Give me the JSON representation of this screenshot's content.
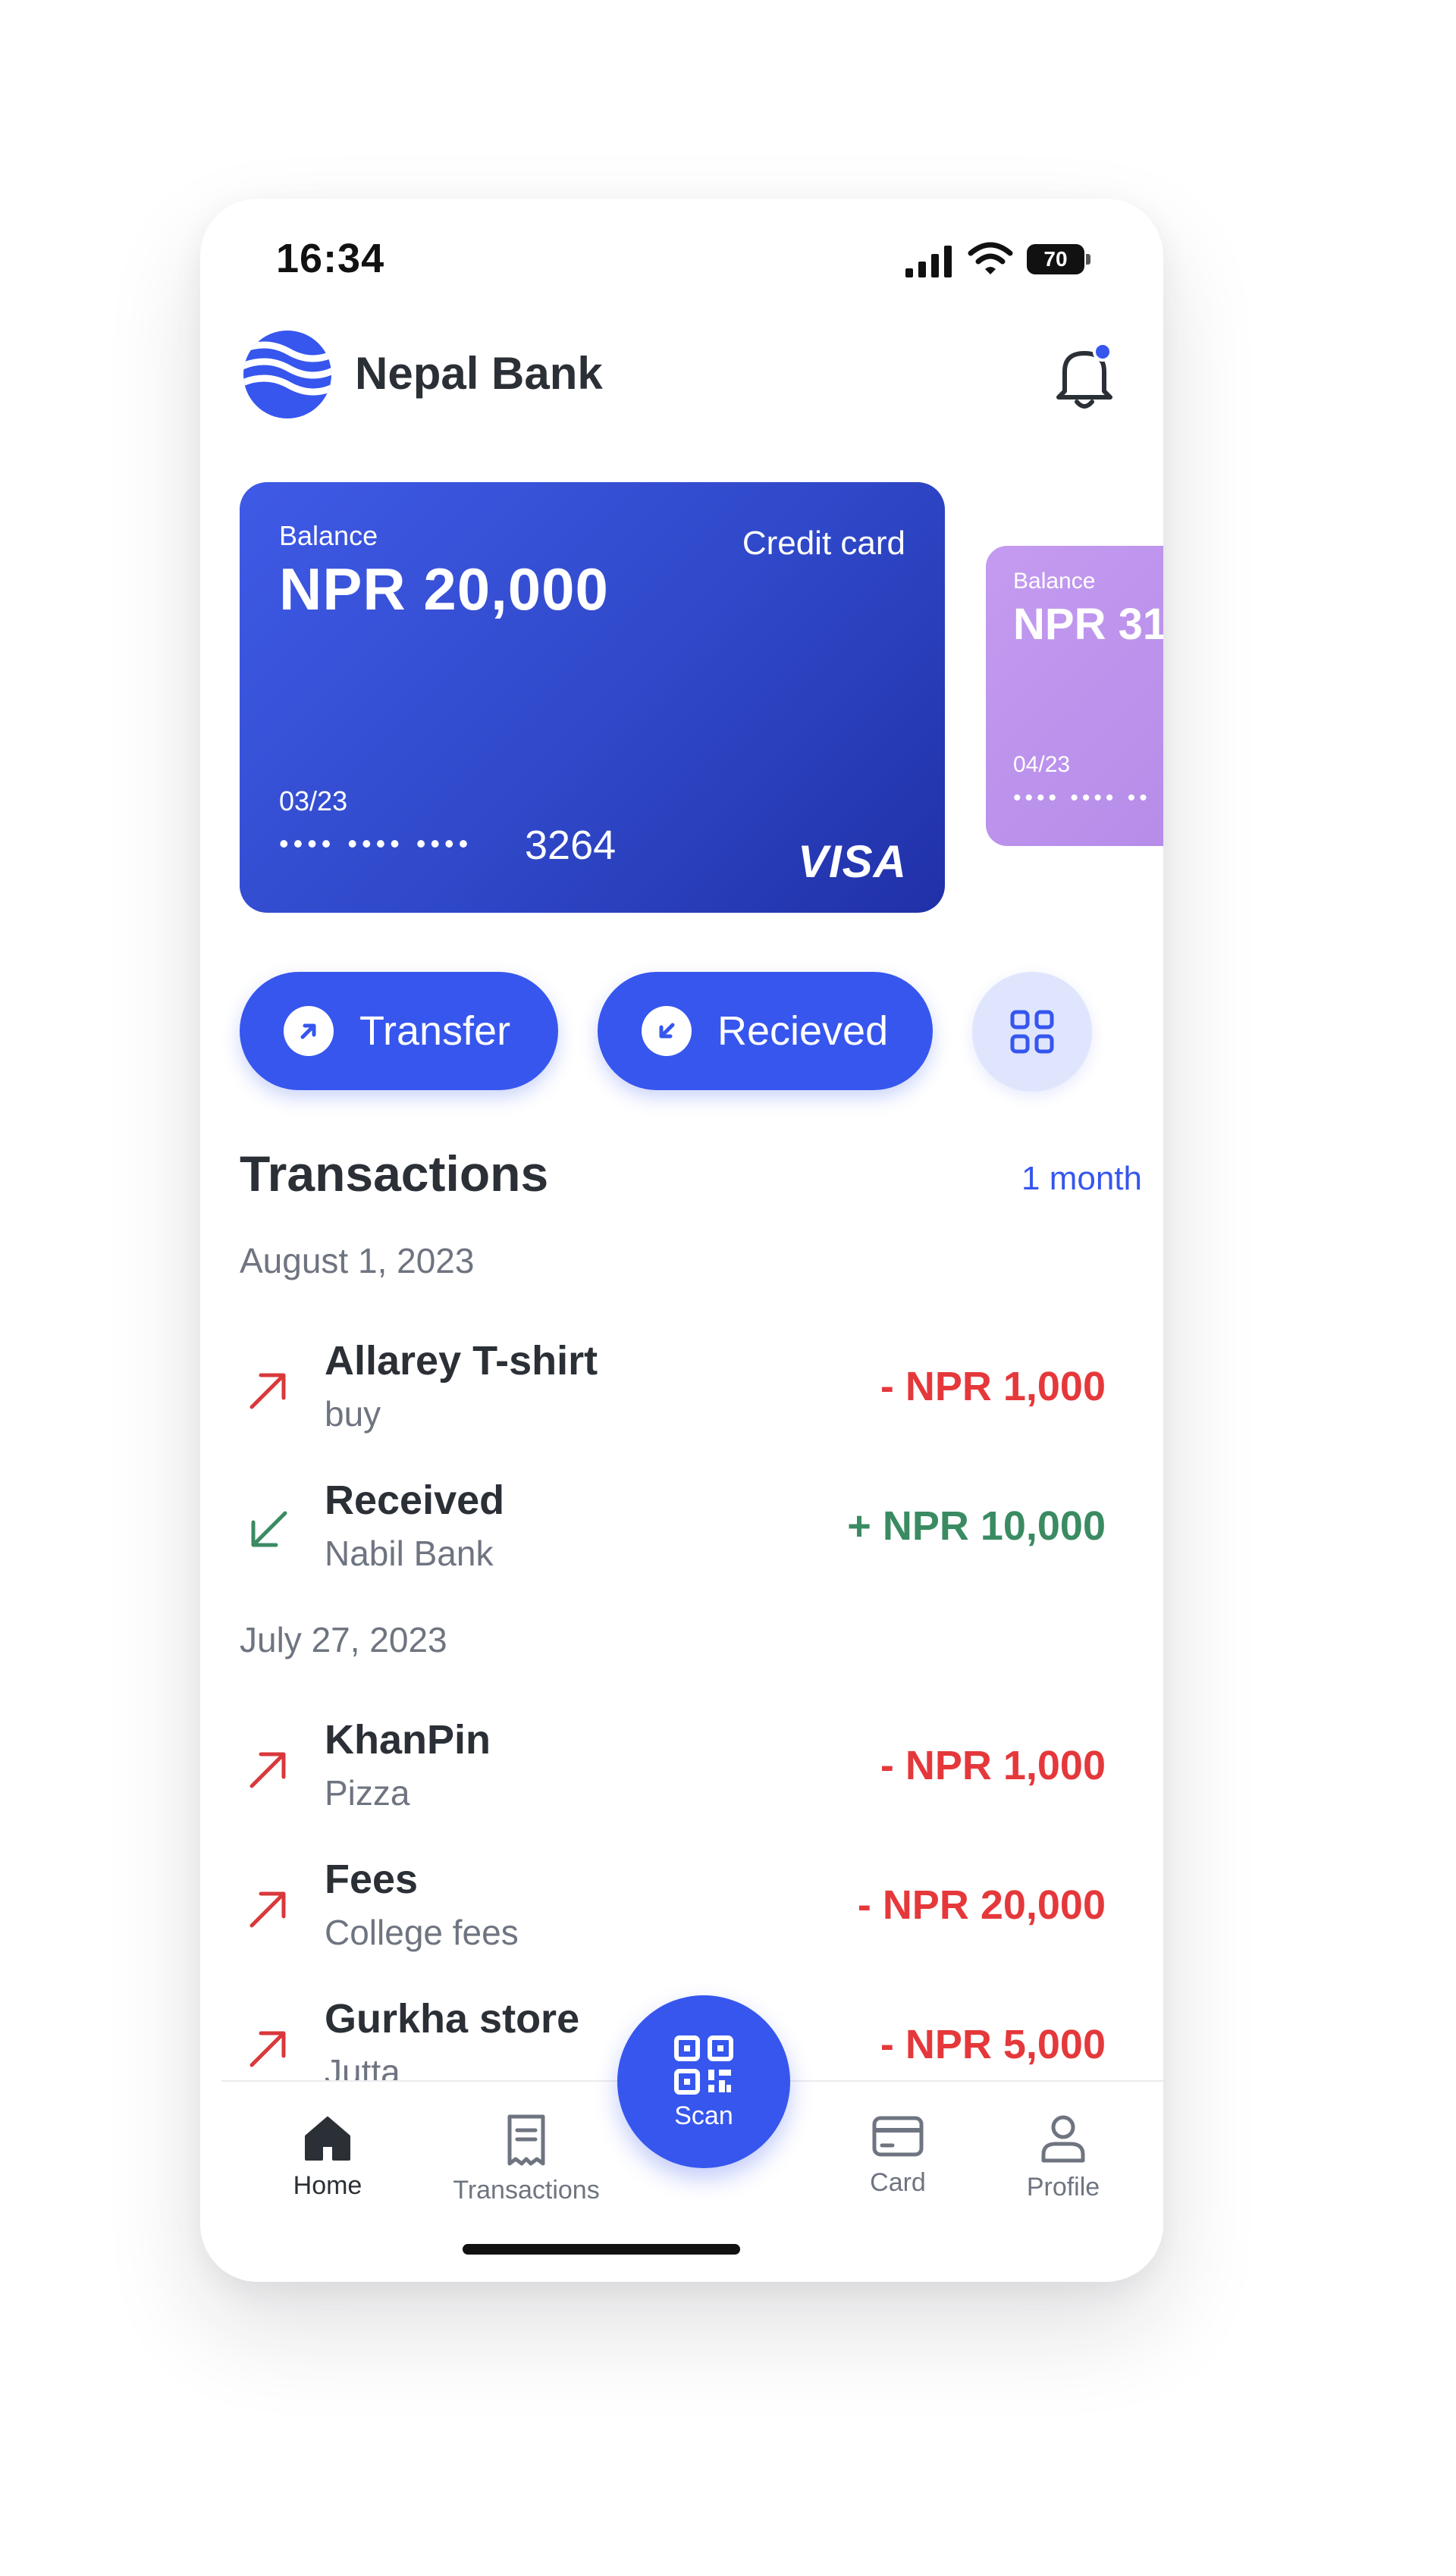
{
  "status_bar": {
    "time": "16:34",
    "battery": "70"
  },
  "header": {
    "brand": "Nepal Bank"
  },
  "cards": [
    {
      "label": "Balance",
      "amount": "NPR 20,000",
      "type": "Credit card",
      "expiry": "03/23",
      "masked": "•••• •••• ••••",
      "last4": "3264",
      "network": "VISA"
    },
    {
      "label": "Balance",
      "amount": "NPR 31",
      "expiry": "04/23",
      "masked": "•••• •••• ••"
    }
  ],
  "actions": {
    "transfer": "Transfer",
    "received": "Recieved"
  },
  "transactions": {
    "title": "Transactions",
    "range": "1 month",
    "groups": [
      {
        "date": "August 1, 2023",
        "items": [
          {
            "name": "Allarey T-shirt",
            "sub": "buy",
            "amount": "- NPR 1,000",
            "direction": "out"
          },
          {
            "name": "Received",
            "sub": "Nabil Bank",
            "amount": "+ NPR 10,000",
            "direction": "in"
          }
        ]
      },
      {
        "date": "July 27, 2023",
        "items": [
          {
            "name": "KhanPin",
            "sub": "Pizza",
            "amount": "- NPR 1,000",
            "direction": "out"
          },
          {
            "name": "Fees",
            "sub": "College fees",
            "amount": "- NPR 20,000",
            "direction": "out"
          },
          {
            "name": "Gurkha store",
            "sub": "Jutta",
            "amount": "- NPR 5,000",
            "direction": "out"
          }
        ]
      }
    ]
  },
  "nav": {
    "home": "Home",
    "transactions": "Transactions",
    "scan": "Scan",
    "card": "Card",
    "profile": "Profile",
    "active": "home"
  },
  "colors": {
    "primary": "#3656ee",
    "negative": "#e5383b",
    "positive": "#3a8b62",
    "card_main": "#2f48c8",
    "card_second": "#c49bf0"
  }
}
